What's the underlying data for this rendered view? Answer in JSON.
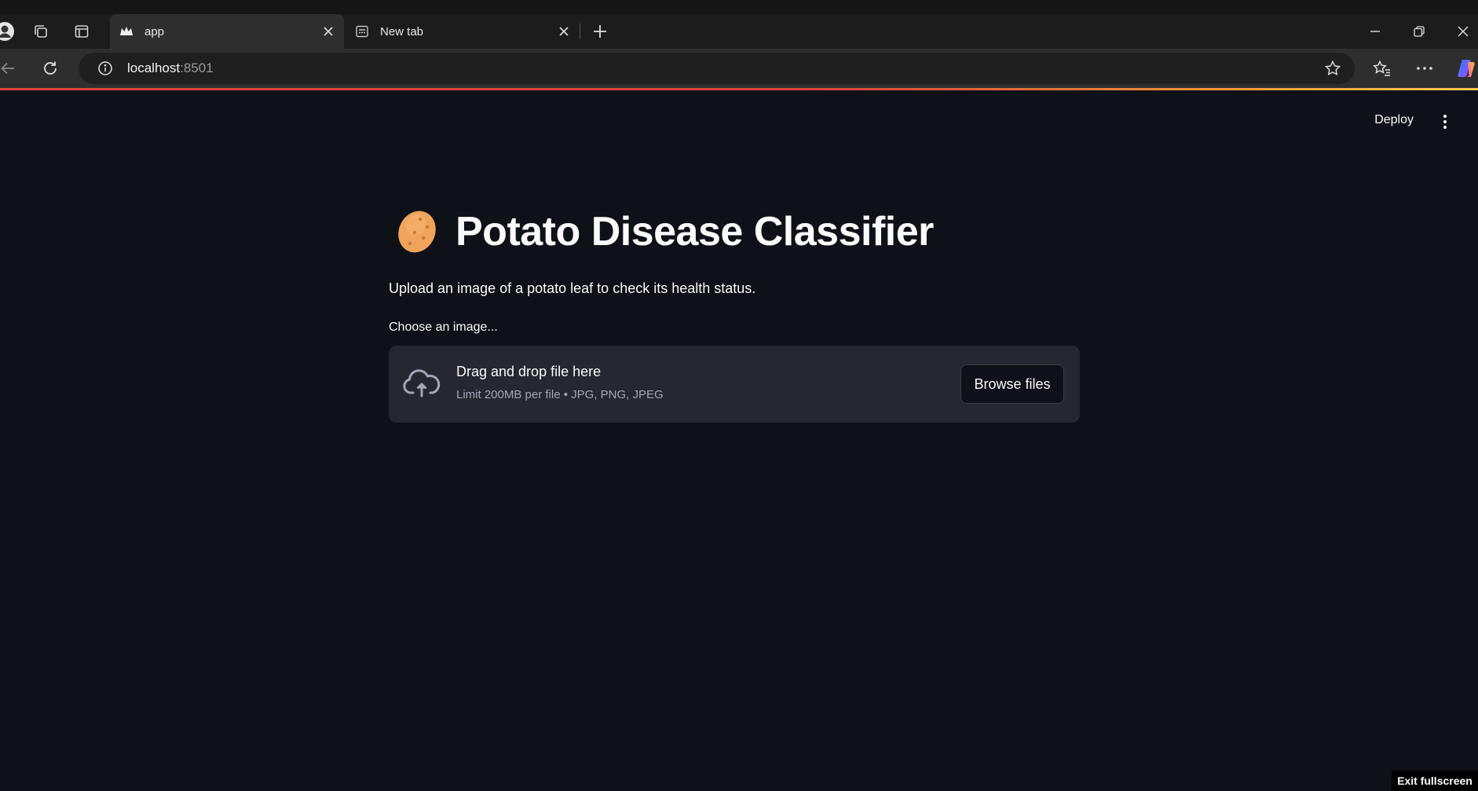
{
  "browser": {
    "tabs": [
      {
        "title": "app",
        "active": true,
        "favicon": "streamlit-crown-icon"
      },
      {
        "title": "New tab",
        "active": false,
        "favicon": "new-tab-icon"
      }
    ],
    "address": {
      "host": "localhost",
      "port": ":8501"
    }
  },
  "header": {
    "deploy_label": "Deploy"
  },
  "main": {
    "title_icon": "potato-icon",
    "title": "Potato Disease Classifier",
    "subtitle": "Upload an image of a potato leaf to check its health status.",
    "uploader": {
      "label": "Choose an image...",
      "drag_text": "Drag and drop file here",
      "limit_text": "Limit 200MB per file • JPG, PNG, JPEG",
      "browse_label": "Browse files"
    }
  },
  "overlay": {
    "exit_fullscreen": "Exit fullscreen"
  },
  "colors": {
    "background": "#0e1117",
    "dropzone": "#262730",
    "accent_bar_start": "#e0433a",
    "accent_bar_end": "#f6c84c"
  }
}
